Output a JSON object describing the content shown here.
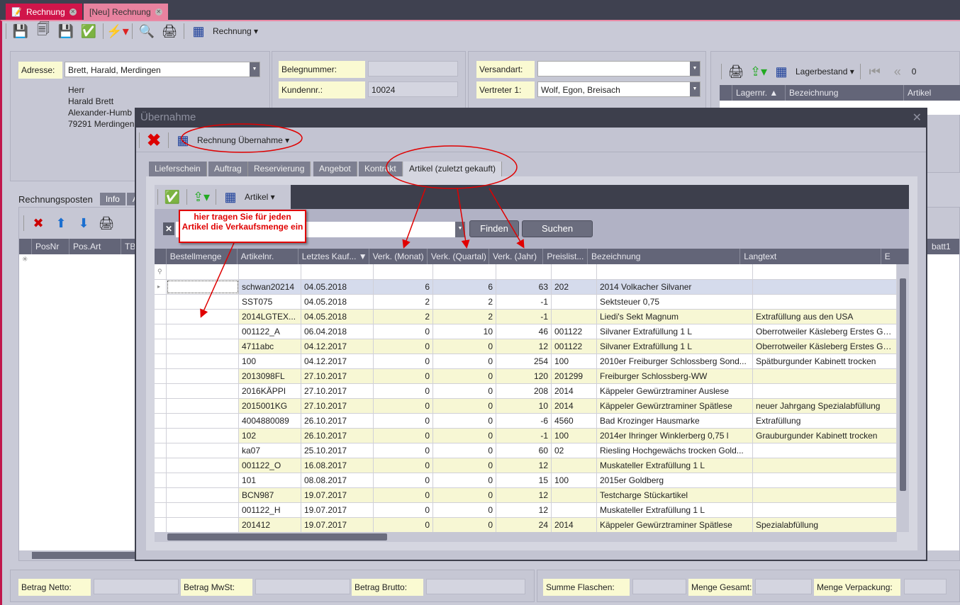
{
  "window_tabs": [
    {
      "label": "Rechnung",
      "active": true
    },
    {
      "label": "[Neu] Rechnung",
      "active": false
    }
  ],
  "toolbar": {
    "view_label": "Rechnung"
  },
  "address": {
    "label": "Adresse:",
    "value": "Brett, Harald, Merdingen",
    "lines": [
      "Herr",
      "Harald Brett",
      "Alexander-Humb",
      "79291 Merdingen"
    ]
  },
  "beleg": {
    "belegnummer_label": "Belegnummer:",
    "belegnummer": "",
    "kundennr_label": "Kundennr.:",
    "kundennr": "10024"
  },
  "versand": {
    "versandart_label": "Versandart:",
    "versandart": "",
    "vertreter_label": "Vertreter 1:",
    "vertreter": "Wolf, Egon, Breisach"
  },
  "lager": {
    "view_label": "Lagerbestand",
    "counter": "0",
    "columns": [
      "Lagernr.",
      "Bezeichnung",
      "Artikel"
    ]
  },
  "positions": {
    "tabs": [
      "Rechnungsposten",
      "Info",
      "A"
    ],
    "columns": [
      "PosNr",
      "Pos.Art",
      "TBS"
    ],
    "right_column": "batt1"
  },
  "footer": {
    "netto_label": "Betrag Netto:",
    "mwst_label": "Betrag MwSt:",
    "brutto_label": "Betrag Brutto:",
    "flaschen_label": "Summe Flaschen:",
    "menge_gesamt_label": "Menge Gesamt:",
    "menge_verpackung_label": "Menge Verpackung:"
  },
  "dialog": {
    "title": "Übernahme",
    "view_label": "Rechnung Übernahme",
    "tabs": [
      "Lieferschein",
      "Auftrag",
      "Reservierung",
      "Angebot",
      "Kontrakt",
      "Artikel (zuletzt gekauft)"
    ],
    "active_tab": "Artikel (zuletzt gekauft)",
    "inner_view_label": "Artikel",
    "search_value": "",
    "find_label": "Finden",
    "search_label": "Suchen",
    "columns": [
      "Bestellmenge",
      "Artikelnr.",
      "Letztes Kauf...",
      "Verk. (Monat)",
      "Verk. (Quartal)",
      "Verk. (Jahr)",
      "Preislist...",
      "Bezeichnung",
      "Langtext",
      "E"
    ],
    "rows": [
      [
        "",
        "schwan20214",
        "04.05.2018",
        "6",
        "6",
        "63",
        "202",
        "2014 Volkacher Silvaner",
        ""
      ],
      [
        "",
        "SST075",
        "04.05.2018",
        "2",
        "2",
        "-1",
        "",
        "Sektsteuer 0,75",
        ""
      ],
      [
        "",
        "2014LGTEX...",
        "04.05.2018",
        "2",
        "2",
        "-1",
        "",
        "Liedi's Sekt Magnum",
        "Extrafüllung aus den USA"
      ],
      [
        "",
        "001122_A",
        "06.04.2018",
        "0",
        "10",
        "46",
        "001122",
        "Silvaner Extrafüllung 1 L",
        "Oberrotweiler Käsleberg Erstes Ge..."
      ],
      [
        "",
        "4711abc",
        "04.12.2017",
        "0",
        "0",
        "12",
        "001122",
        "Silvaner Extrafüllung 1 L",
        "Oberrotweiler Käsleberg Erstes Ge..."
      ],
      [
        "",
        "100",
        "04.12.2017",
        "0",
        "0",
        "254",
        "100",
        "2010er Freiburger Schlossberg Sond...",
        "Spätburgunder Kabinett trocken"
      ],
      [
        "",
        "2013098FL",
        "27.10.2017",
        "0",
        "0",
        "120",
        "201299",
        "Freiburger Schlossberg-WW",
        ""
      ],
      [
        "",
        "2016KÄPPI",
        "27.10.2017",
        "0",
        "0",
        "208",
        "2014",
        "Käppeler Gewürztraminer Auslese",
        ""
      ],
      [
        "",
        "2015001KG",
        "27.10.2017",
        "0",
        "0",
        "10",
        "2014",
        "Käppeler Gewürztraminer Spätlese",
        "neuer Jahrgang Spezialabfüllung"
      ],
      [
        "",
        "4004880089",
        "26.10.2017",
        "0",
        "0",
        "-6",
        "4560",
        "Bad Krozinger Hausmarke",
        "Extrafüllung"
      ],
      [
        "",
        "102",
        "26.10.2017",
        "0",
        "0",
        "-1",
        "100",
        "2014er Ihringer Winklerberg 0,75 l",
        "Grauburgunder Kabinett trocken"
      ],
      [
        "",
        "ka07",
        "25.10.2017",
        "0",
        "0",
        "60",
        "02",
        "Riesling Hochgewächs trocken Gold...",
        ""
      ],
      [
        "",
        "001122_O",
        "16.08.2017",
        "0",
        "0",
        "12",
        "",
        "Muskateller Extrafüllung 1 L",
        ""
      ],
      [
        "",
        "101",
        "08.08.2017",
        "0",
        "0",
        "15",
        "100",
        "2015er Goldberg",
        ""
      ],
      [
        "",
        "BCN987",
        "19.07.2017",
        "0",
        "0",
        "12",
        "",
        "Testcharge Stückartikel",
        ""
      ],
      [
        "",
        "001122_H",
        "19.07.2017",
        "0",
        "0",
        "12",
        "",
        "Muskateller Extrafüllung 1 L",
        ""
      ],
      [
        "",
        "201412",
        "19.07.2017",
        "0",
        "0",
        "24",
        "2014",
        "Käppeler Gewürztraminer Spätlese",
        "Spezialabfüllung"
      ]
    ]
  },
  "annotation": {
    "callout": "hier tragen Sie für jeden Artikel die Verkaufsmenge ein"
  },
  "colors": {
    "accent": "#d0154a",
    "annotation": "#e00000",
    "row_alt": "#f7f7d4",
    "row_selected": "#d5dbec"
  }
}
